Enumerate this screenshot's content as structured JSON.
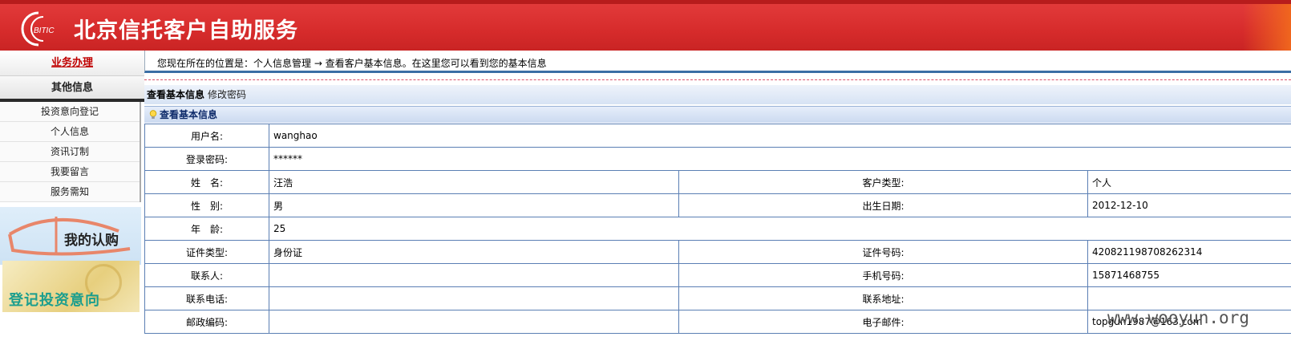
{
  "header": {
    "logo_text": "BITIC",
    "title": "北京信托客户自助服务"
  },
  "sidebar": {
    "business_tab": "业务办理",
    "other_tab": "其他信息",
    "items": [
      {
        "label": "投资意向登记"
      },
      {
        "label": "个人信息"
      },
      {
        "label": "资讯订制"
      },
      {
        "label": "我要留言"
      },
      {
        "label": "服务需知"
      }
    ],
    "promo_subscription": "我的认购",
    "promo_register": "登记投资意向"
  },
  "breadcrumb": {
    "text": "您现在所在的位置是：个人信息管理 → 查看客户基本信息。在这里您可以看到您的基本信息"
  },
  "tabs": {
    "active": "查看基本信息",
    "other": "修改密码"
  },
  "panel": {
    "title": "查看基本信息"
  },
  "info": {
    "username_label": "用户名:",
    "username": "wanghao",
    "password_label": "登录密码:",
    "password": "******",
    "name_label": "姓　名:",
    "name": "汪浩",
    "customer_type_label": "客户类型:",
    "customer_type": "个人",
    "gender_label": "性　别:",
    "gender": "男",
    "birth_label": "出生日期:",
    "birth": "2012-12-10",
    "age_label": "年　龄:",
    "age": "25",
    "id_type_label": "证件类型:",
    "id_type": "身份证",
    "id_number_label": "证件号码:",
    "id_number": "420821198708262314",
    "contact_label": "联系人:",
    "contact": "",
    "mobile_label": "手机号码:",
    "mobile": "15871468755",
    "phone_label": "联系电话:",
    "phone": "",
    "address_label": "联系地址:",
    "address": "",
    "postcode_label": "邮政编码:",
    "postcode": "",
    "email_label": "电子邮件:",
    "email": "topgun1987@163.com"
  },
  "watermark": "www.wooyun.org",
  "colors": {
    "header_red": "#d62b2b",
    "nav_red": "#c00000",
    "table_border": "#5b7fb4",
    "promo_teal": "#1b9e8e"
  }
}
